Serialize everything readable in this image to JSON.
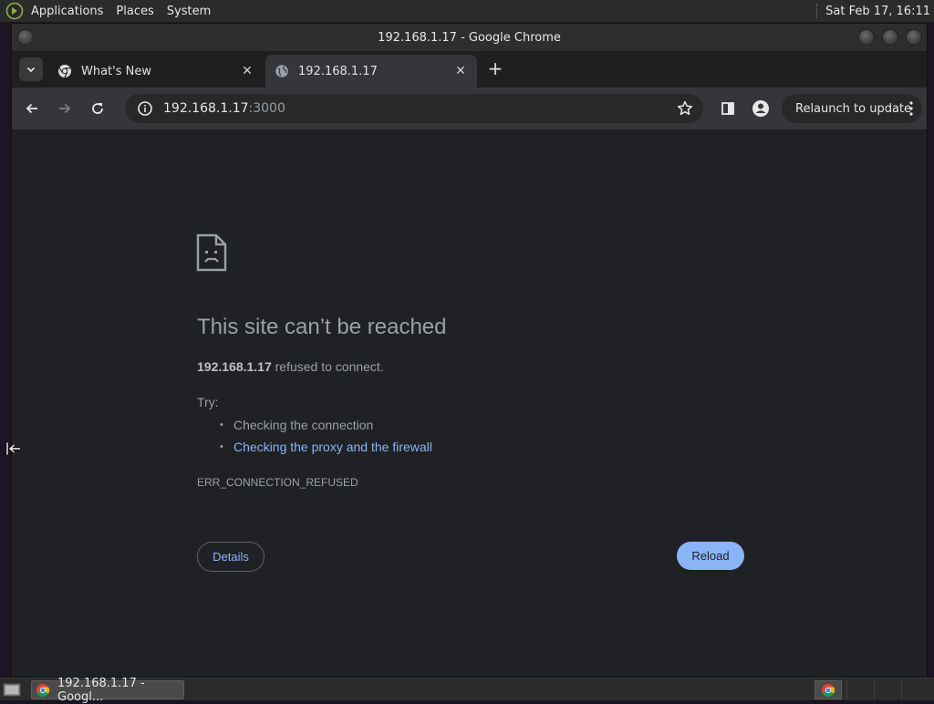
{
  "panel": {
    "menus": [
      "Applications",
      "Places",
      "System"
    ],
    "clock": "Sat Feb 17, 16:11"
  },
  "window": {
    "title": "192.168.1.17 - Google Chrome"
  },
  "tabs": [
    {
      "title": "What's New",
      "icon": "chrome-icon",
      "active": false
    },
    {
      "title": "192.168.1.17",
      "icon": "globe-icon",
      "active": true
    }
  ],
  "toolbar": {
    "url_host": "192.168.1.17",
    "url_port": ":3000",
    "relaunch_label": "Relaunch to update"
  },
  "error": {
    "heading": "This site can’t be reached",
    "host": "192.168.1.17",
    "message_rest": " refused to connect.",
    "try_label": "Try:",
    "suggestions": [
      "Checking the connection",
      "Checking the proxy and the firewall"
    ],
    "code": "ERR_CONNECTION_REFUSED",
    "details_label": "Details",
    "reload_label": "Reload"
  },
  "taskbar": {
    "task_label": "192.168.1.17 - Googl..."
  },
  "colors": {
    "link": "#8ab4f8",
    "page_bg": "#202124",
    "toolbar_bg": "#35363a"
  }
}
